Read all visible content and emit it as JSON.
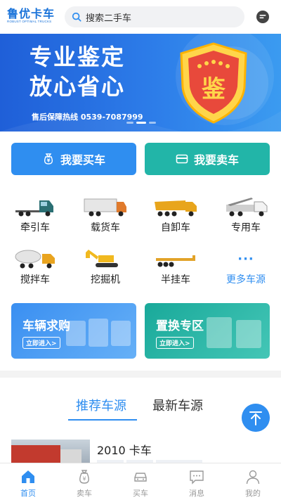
{
  "header": {
    "logo_cn": "鲁优卡车",
    "logo_en": "ROBUST OPTIMAL TRUCKS",
    "search_placeholder": "搜索二手车"
  },
  "banner": {
    "line1": "专业鉴定",
    "line2": "放心省心",
    "badge_char": "鉴",
    "hotline": "售后保障热线 0539-7087999"
  },
  "actions": {
    "buy_label": "我要买车",
    "sell_label": "我要卖车",
    "buy_color": "#2f8ef0",
    "sell_color": "#22b5a8"
  },
  "categories": [
    {
      "label": "牵引车",
      "icon": "tractor-truck-icon"
    },
    {
      "label": "载货车",
      "icon": "cargo-truck-icon"
    },
    {
      "label": "自卸车",
      "icon": "dump-truck-icon"
    },
    {
      "label": "专用车",
      "icon": "special-truck-icon"
    },
    {
      "label": "搅拌车",
      "icon": "mixer-truck-icon"
    },
    {
      "label": "挖掘机",
      "icon": "excavator-icon"
    },
    {
      "label": "半挂车",
      "icon": "semi-trailer-icon"
    },
    {
      "label": "更多车源",
      "icon": "more-dots-icon",
      "more_dots": "···"
    }
  ],
  "promos": [
    {
      "title": "车辆求购",
      "tag": "立即进入>"
    },
    {
      "title": "置换专区",
      "tag": "立即进入>"
    }
  ],
  "tabs": [
    {
      "label": "推荐车源",
      "active": true
    },
    {
      "label": "最新车源",
      "active": false
    }
  ],
  "listing": {
    "title": "2010 卡车"
  },
  "bottom_nav": [
    {
      "label": "首页",
      "icon": "home-icon",
      "active": true
    },
    {
      "label": "卖车",
      "icon": "money-bag-icon",
      "active": false
    },
    {
      "label": "买车",
      "icon": "car-icon",
      "active": false
    },
    {
      "label": "消息",
      "icon": "message-icon",
      "active": false
    },
    {
      "label": "我的",
      "icon": "user-icon",
      "active": false
    }
  ]
}
